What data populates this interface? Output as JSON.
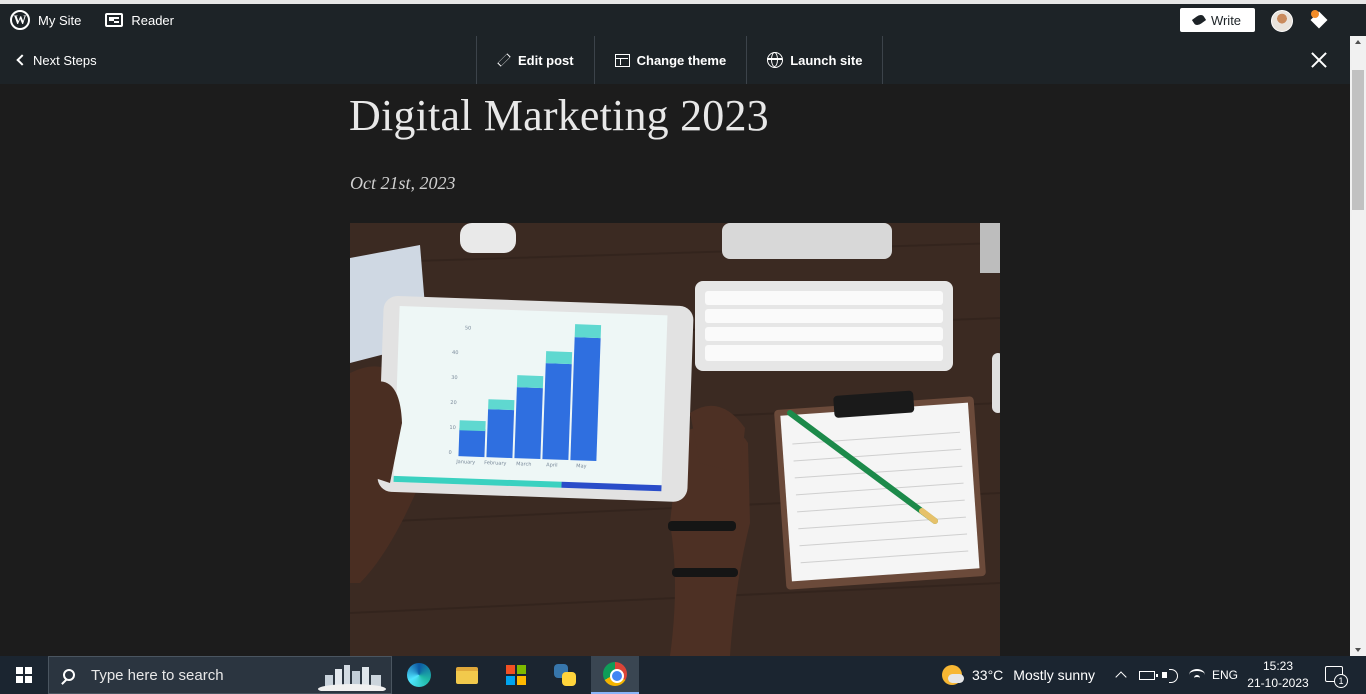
{
  "masterbar": {
    "my_site_label": "My Site",
    "reader_label": "Reader",
    "write_label": "Write"
  },
  "toolbar": {
    "next_steps_label": "Next Steps",
    "edit_post_label": "Edit post",
    "change_theme_label": "Change theme",
    "launch_site_label": "Launch site"
  },
  "post": {
    "title": "Digital Marketing 2023",
    "date": "Oct 21st, 2023",
    "image_chart": {
      "y_ticks": [
        "0",
        "10",
        "20",
        "30",
        "40",
        "50"
      ],
      "months": [
        "January",
        "February",
        "March",
        "April",
        "May"
      ]
    }
  },
  "taskbar": {
    "search_placeholder": "Type here to search",
    "weather_temp": "33°C",
    "weather_desc": "Mostly sunny",
    "language": "ENG",
    "time": "15:23",
    "date": "21-10-2023",
    "notification_count": "1"
  },
  "colors": {
    "masterbar_bg": "#1d2327",
    "page_bg": "#1c1c1c",
    "taskbar_bg": "#1b2530"
  }
}
